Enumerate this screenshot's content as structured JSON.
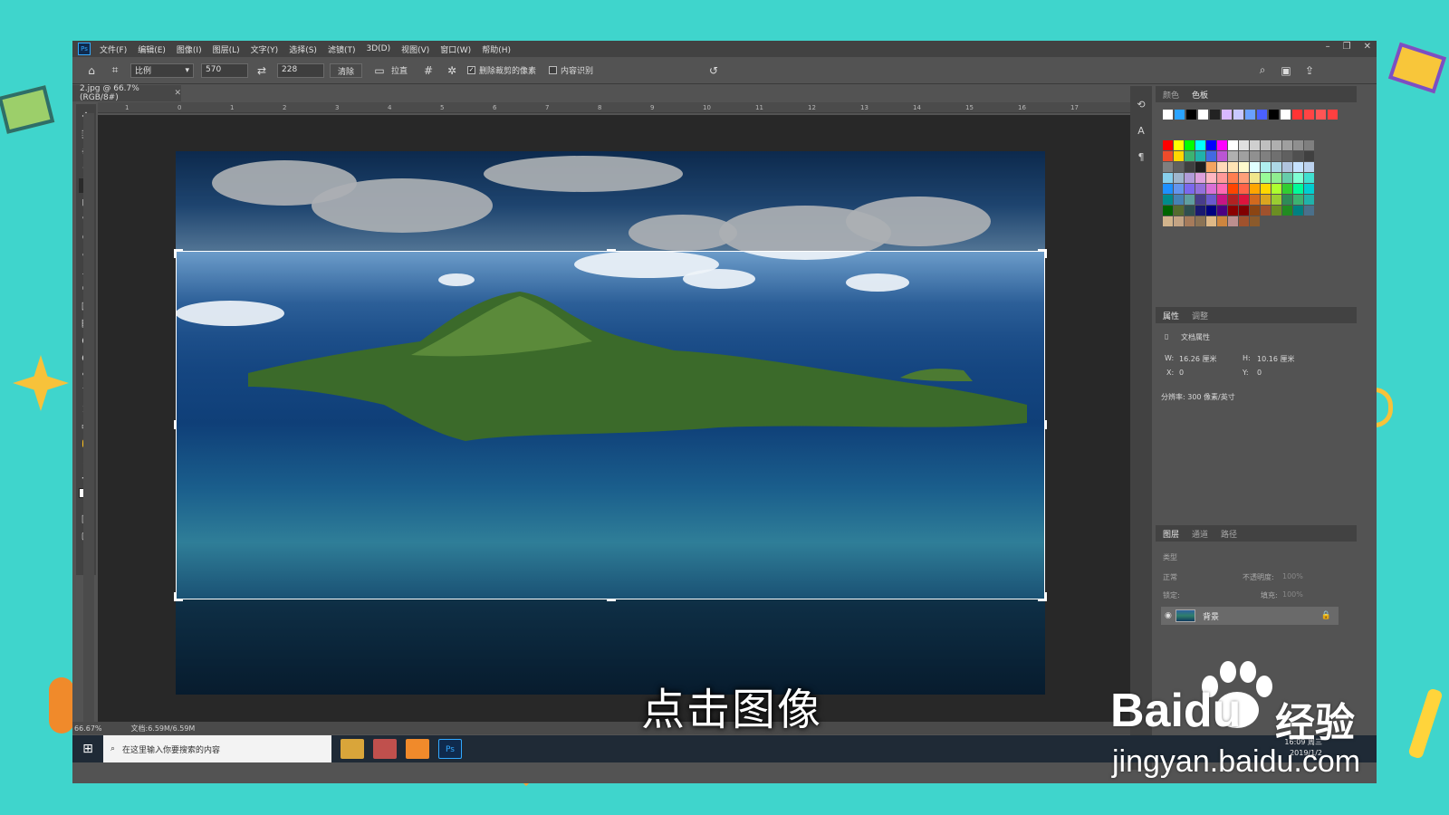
{
  "colors": {
    "accent": "#31a8ff",
    "background": "#3fd5cc",
    "panel": "#535353",
    "canvas": "#282828"
  },
  "menu": {
    "app_icon": "Ps",
    "items": [
      "文件(F)",
      "编辑(E)",
      "图像(I)",
      "图层(L)",
      "文字(Y)",
      "选择(S)",
      "滤镜(T)",
      "3D(D)",
      "视图(V)",
      "窗口(W)",
      "帮助(H)"
    ]
  },
  "options": {
    "ratio_label": "比例",
    "width_value": "570",
    "height_value": "228",
    "clear_label": "清除",
    "straighten_label": "拉直",
    "delete_cropped_label": "删除裁剪的像素",
    "content_aware_label": "内容识别"
  },
  "document": {
    "tab_title": "2.jpg @ 66.7%(RGB/8#)"
  },
  "ruler": {
    "ticks": [
      "1",
      "0",
      "1",
      "2",
      "3",
      "4",
      "5",
      "6",
      "7",
      "8",
      "9",
      "10",
      "11",
      "12",
      "13",
      "14",
      "15",
      "16",
      "17"
    ]
  },
  "panels": {
    "color_tab": "颜色",
    "swatches_tab": "色板",
    "properties_tab": "属性",
    "adjustments_tab": "调整",
    "doc_props_label": "文档属性",
    "w_label": "W:",
    "w_value": "16.26 厘米",
    "h_label": "H:",
    "h_value": "10.16 厘米",
    "x_label": "X:",
    "x_value": "0",
    "y_label": "Y:",
    "y_value": "0",
    "resolution_label": "分辨率: 300 像素/英寸",
    "layers_tab": "图层",
    "channels_tab": "通道",
    "paths_tab": "路径",
    "layer_filter": "类型",
    "blend_mode": "正常",
    "opacity_label": "不透明度:",
    "opacity_value": "100%",
    "lock_label": "锁定:",
    "fill_label": "填充:",
    "fill_value": "100%",
    "layer_name": "背景"
  },
  "status": {
    "zoom": "66.67%",
    "doc_size": "文档:6.59M/6.59M"
  },
  "taskbar": {
    "search_placeholder": "在这里输入你要搜索的内容",
    "clock_time": "16:09 周三",
    "clock_date": "2019/1/2"
  },
  "overlay": {
    "subtitle": "点击图像",
    "watermark_brand": "Baidu",
    "watermark_cn": "经验",
    "watermark_url": "jingyan.baidu.com"
  }
}
